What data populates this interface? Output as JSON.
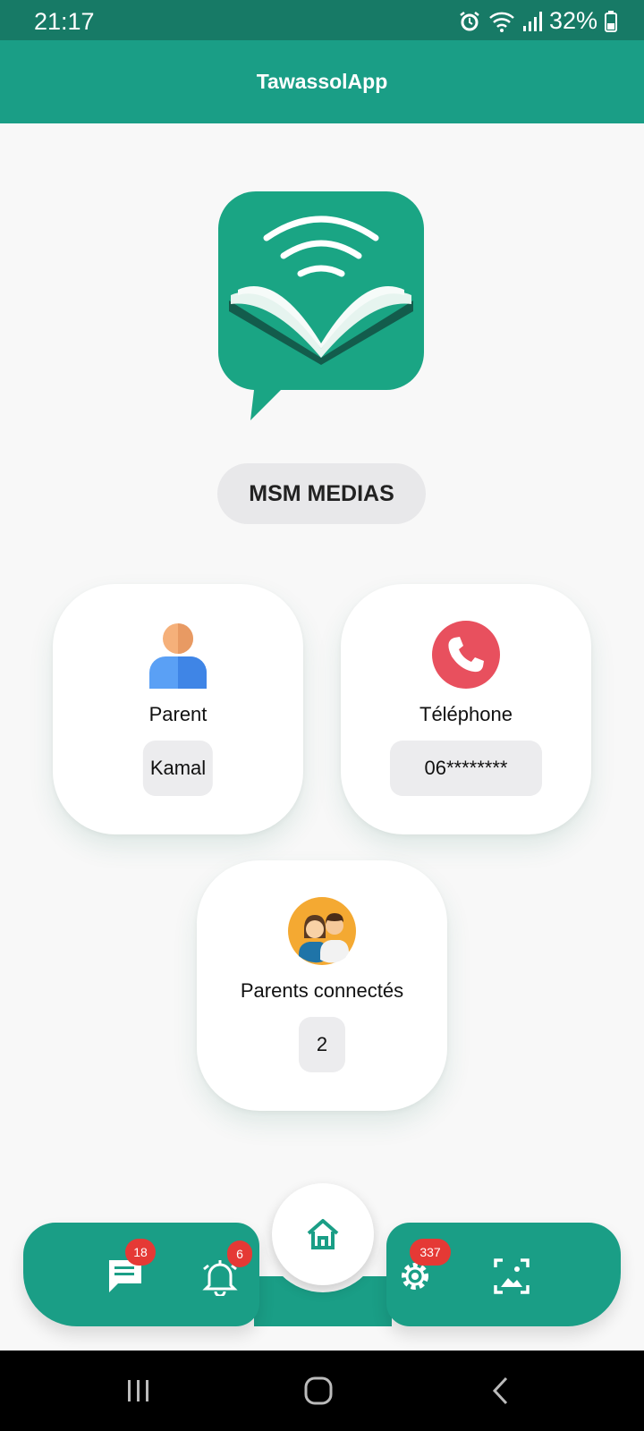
{
  "status_bar": {
    "time": "21:17",
    "battery": "32%"
  },
  "app_bar": {
    "title": "TawassolApp"
  },
  "school": {
    "name": "MSM MEDIAS"
  },
  "cards": {
    "parent": {
      "label": "Parent",
      "value": "Kamal",
      "icon": "user-icon"
    },
    "phone": {
      "label": "Téléphone",
      "value": "06********",
      "icon": "phone-icon"
    },
    "connected": {
      "label": "Parents connectés",
      "value": "2",
      "icon": "parents-icon"
    }
  },
  "bottom_nav": {
    "messages": {
      "icon": "chat-icon",
      "badge": "18"
    },
    "notifications": {
      "icon": "bell-icon",
      "badge": "6"
    },
    "home": {
      "icon": "home-icon"
    },
    "settings": {
      "icon": "gear-icon",
      "badge": "337"
    },
    "gallery": {
      "icon": "image-icon"
    }
  },
  "colors": {
    "status_bar": "#177a66",
    "primary": "#1a9e86",
    "badge": "#e53935",
    "logo": "#1aa584"
  }
}
